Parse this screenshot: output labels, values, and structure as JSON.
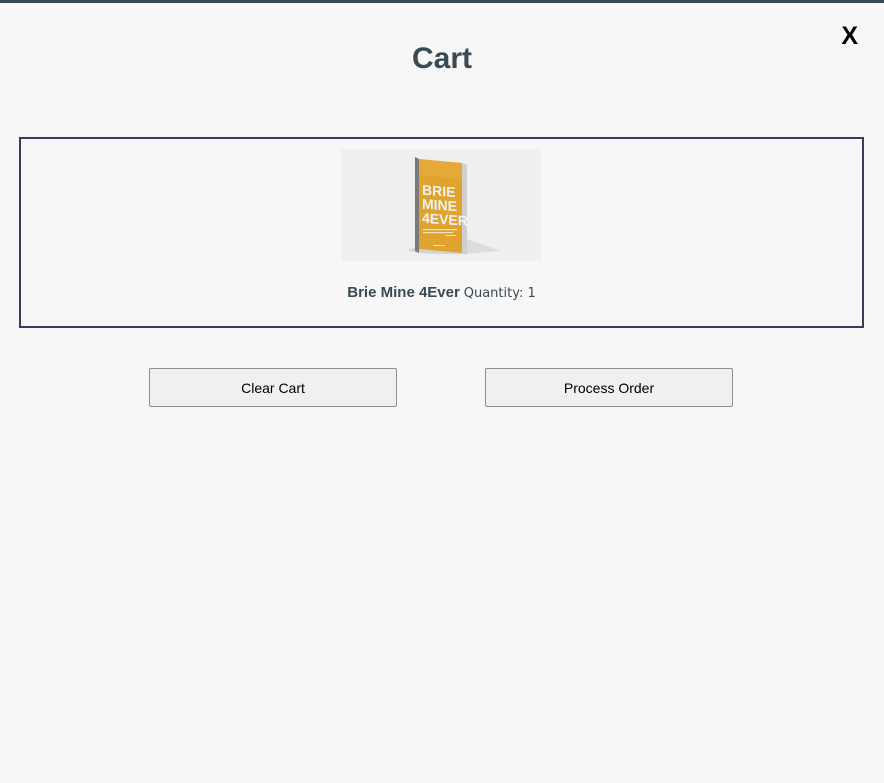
{
  "window": {
    "close_label": "X"
  },
  "page": {
    "title": "Cart"
  },
  "cart": {
    "items": [
      {
        "title": "Brie Mine 4Ever",
        "quantity_label": "Quantity: 1",
        "cover_text": "BRIE MINE 4EVER",
        "cover_color": "#e0a32e"
      }
    ]
  },
  "actions": {
    "clear_label": "Clear Cart",
    "process_label": "Process Order"
  },
  "colors": {
    "accent": "#3a4a55",
    "cart_border": "#3e3a5e",
    "background": "#f7f7f7"
  }
}
